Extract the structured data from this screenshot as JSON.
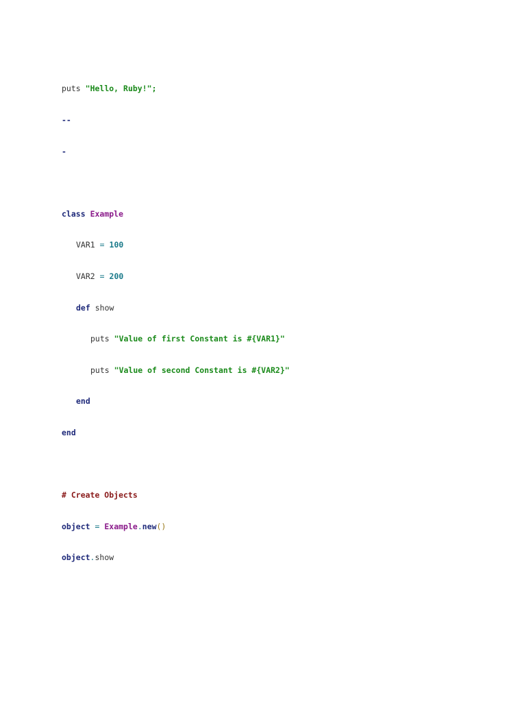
{
  "code": {
    "line1": {
      "kw": "puts",
      "str": "\"Hello, Ruby!\";"
    },
    "line2": "--",
    "line3": "-",
    "line5": {
      "kw": "class",
      "cls": "Example"
    },
    "line6": {
      "name": "VAR1",
      "op": "=",
      "num": "100"
    },
    "line7": {
      "name": "VAR2",
      "op": "=",
      "num": "200"
    },
    "line8": {
      "kw": "def",
      "name": "show"
    },
    "line9": {
      "kw": "puts",
      "str": "\"Value of first Constant is #{VAR1}\""
    },
    "line10": {
      "kw": "puts",
      "str": "\"Value of second Constant is #{VAR2}\""
    },
    "line11": {
      "kw": "end"
    },
    "line12": {
      "kw": "end"
    },
    "line14": {
      "cmt": "# Create Objects"
    },
    "line15": {
      "obj": "object",
      "op": "=",
      "cls": "Example",
      "dot": ".",
      "method": "new",
      "paren": "()"
    },
    "line16": {
      "obj": "object",
      "dot": ".",
      "method": "show"
    }
  }
}
